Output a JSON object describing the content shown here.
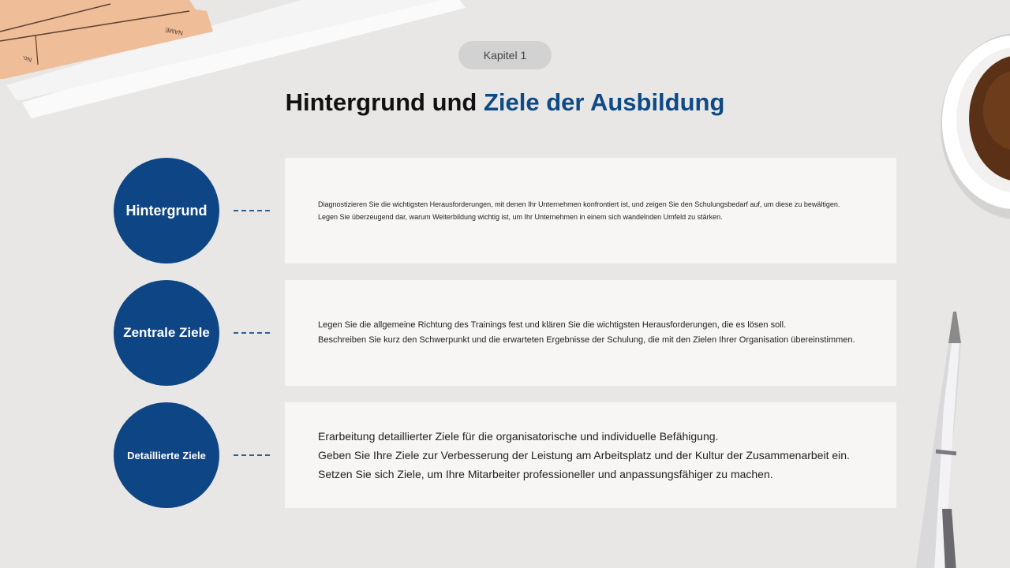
{
  "header": {
    "chapter": "Kapitel 1",
    "title_main": "Hintergrund und ",
    "title_accent": "Ziele der Ausbildung"
  },
  "decor": {
    "folder_tab_label": "NAME",
    "folder_no_label": "No."
  },
  "rows": [
    {
      "label": "Hintergrund",
      "lines": [
        "Diagnostizieren Sie die wichtigsten Herausforderungen, mit denen Ihr Unternehmen konfrontiert ist, und zeigen Sie den Schulungsbedarf auf, um diese zu bewältigen.",
        "Legen Sie überzeugend dar, warum Weiterbildung wichtig ist, um Ihr Unternehmen in einem sich wandelnden Umfeld zu stärken."
      ]
    },
    {
      "label": "Zentrale Ziele",
      "lines": [
        "Legen Sie die allgemeine Richtung des Trainings fest und klären Sie die wichtigsten Herausforderungen, die es lösen soll.",
        "Beschreiben Sie kurz den Schwerpunkt und die erwarteten Ergebnisse der Schulung, die mit den Zielen Ihrer Organisation übereinstimmen."
      ]
    },
    {
      "label": "Detaillierte Ziele",
      "lines": [
        "Erarbeitung detaillierter Ziele für die organisatorische und individuelle Befähigung.",
        "Geben Sie Ihre Ziele zur Verbesserung der Leistung am Arbeitsplatz und der Kultur der Zusammenarbeit ein.",
        "Setzen Sie sich Ziele, um Ihre Mitarbeiter professioneller und anpassungsfähiger zu machen."
      ]
    }
  ],
  "colors": {
    "accent": "#0e4a86",
    "circle": "#0e4585",
    "card": "#f7f6f4",
    "background": "#e8e7e5"
  }
}
